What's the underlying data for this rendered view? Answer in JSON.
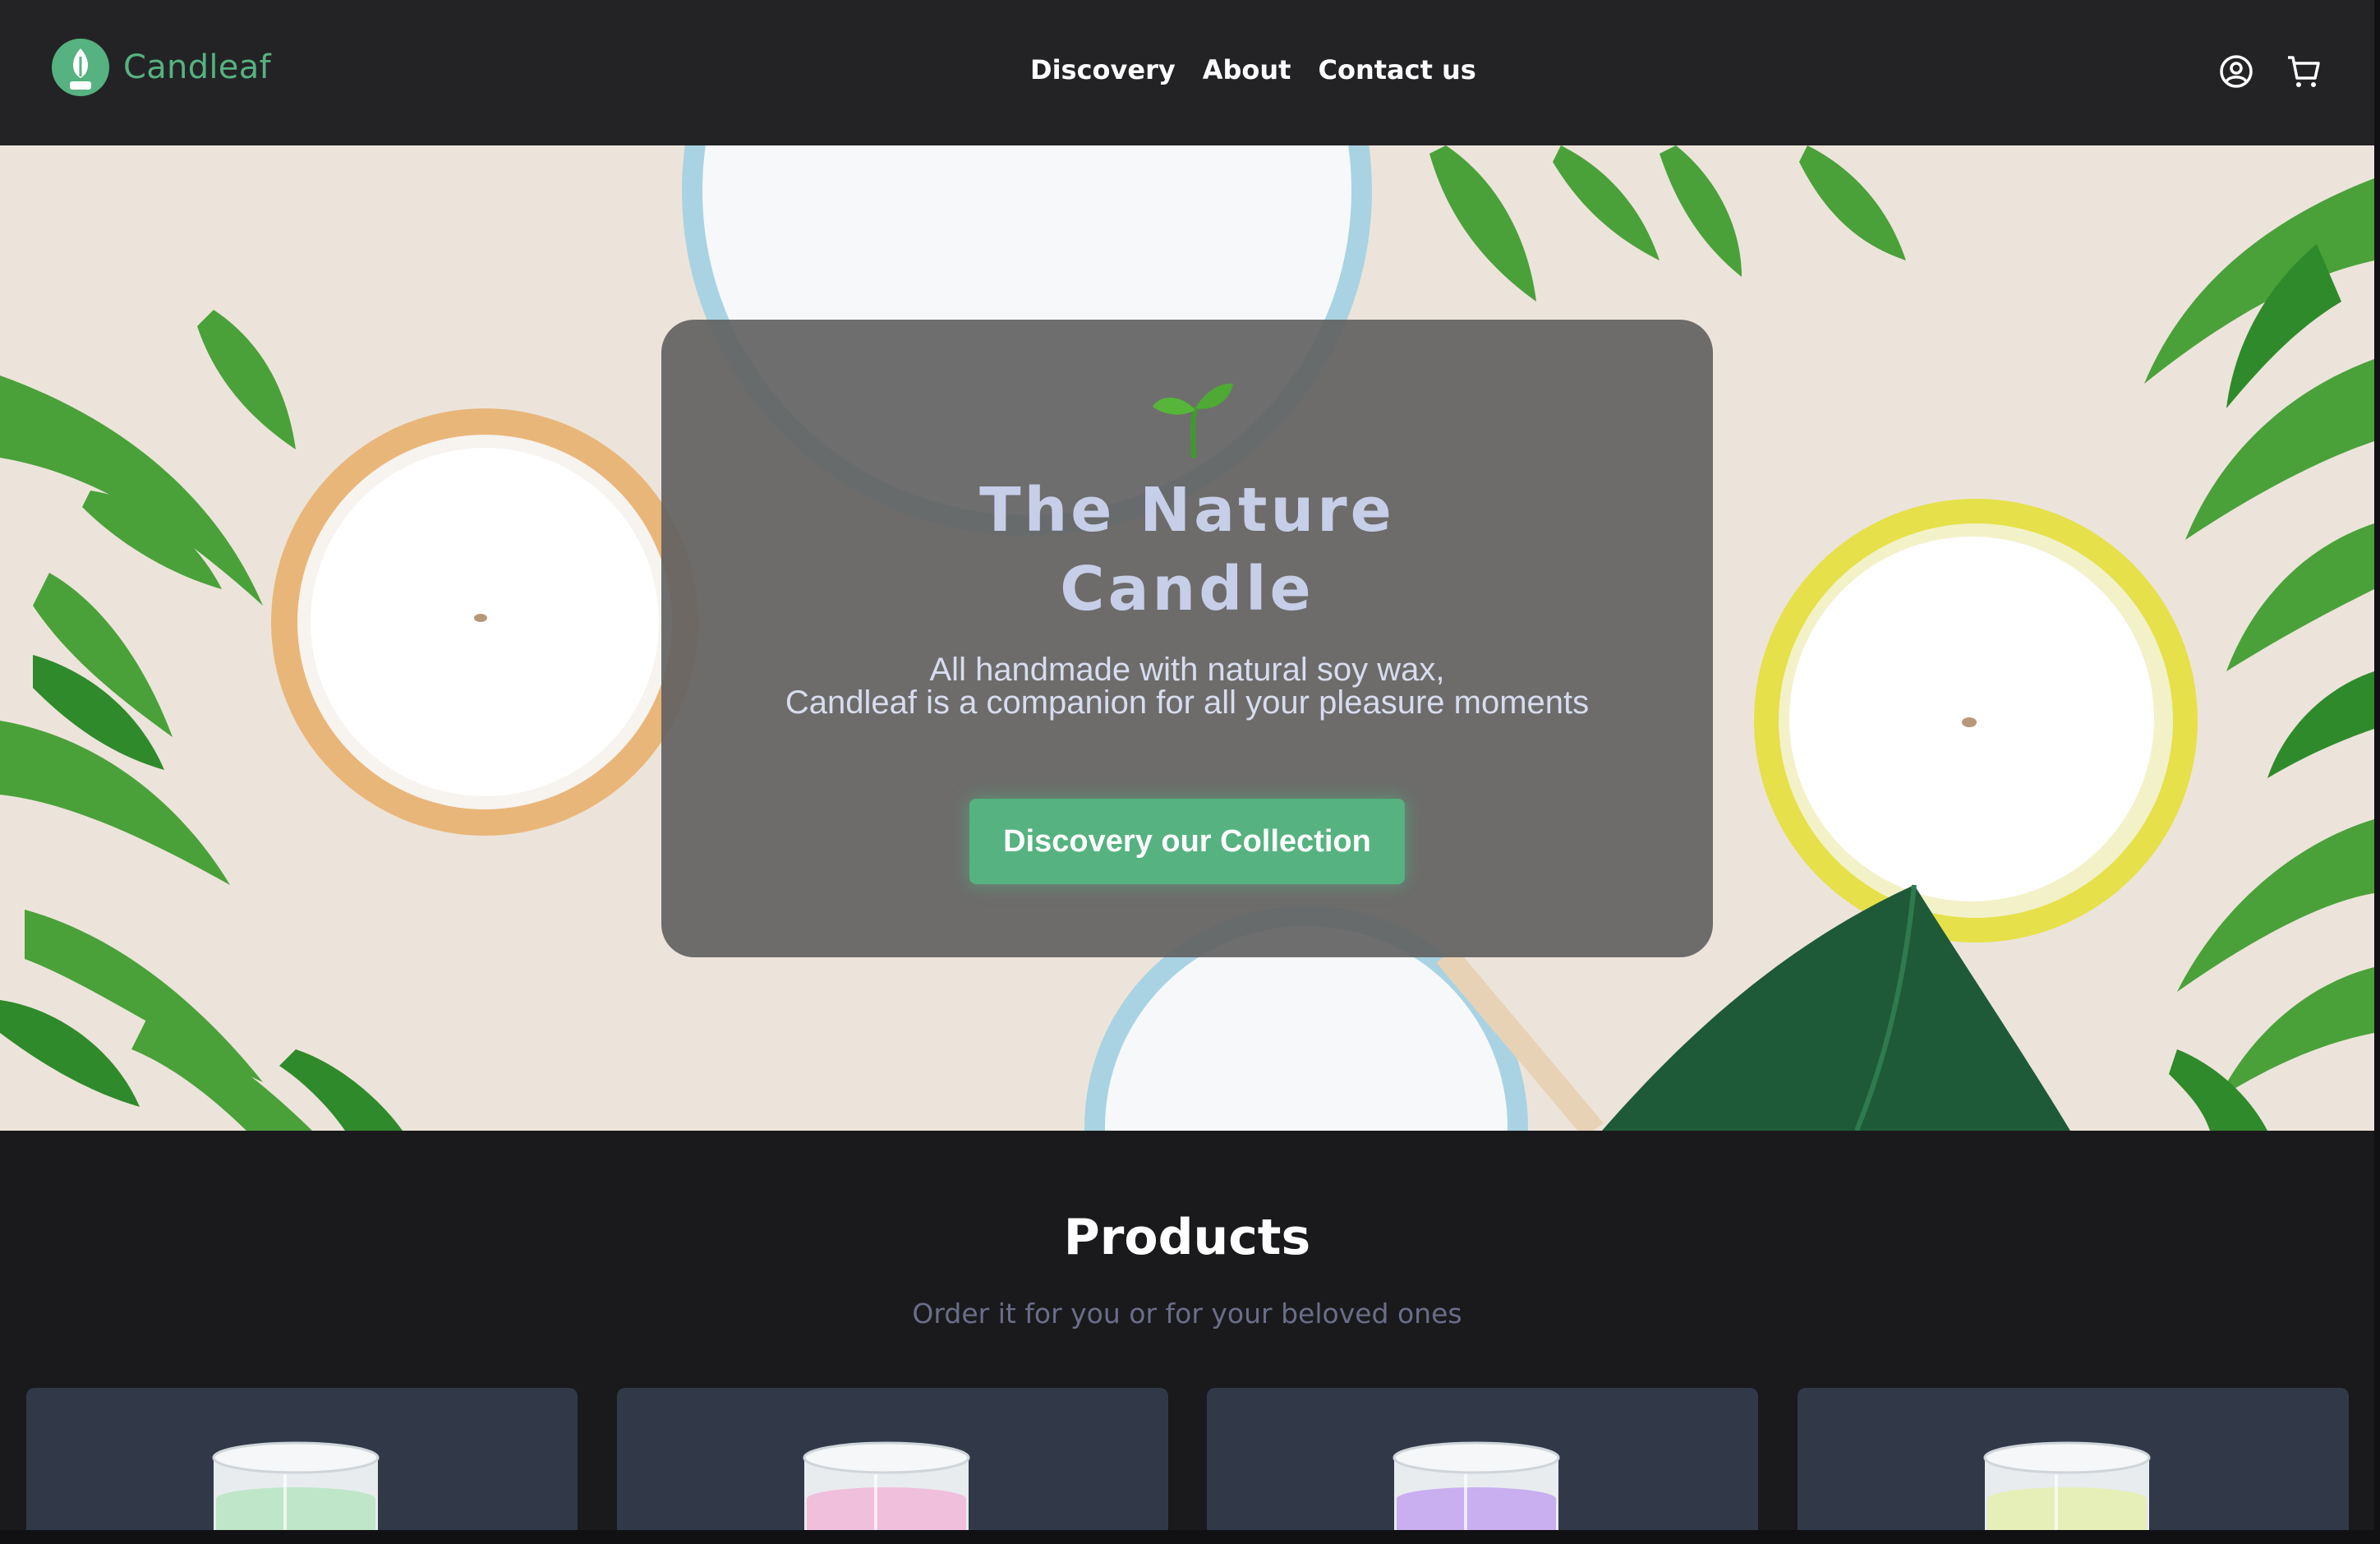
{
  "brand": {
    "name": "Candleaf",
    "accent": "#56b280"
  },
  "nav": {
    "items": [
      "Discovery",
      "About",
      "Contact us"
    ]
  },
  "header_icons": [
    "user-icon",
    "cart-icon"
  ],
  "hero": {
    "title_line1": "The Nature",
    "title_line2": "Candle",
    "subtitle_line1": "All handmade with natural soy wax,",
    "subtitle_line2": "Candleaf is a companion for all your pleasure moments",
    "cta_label": "Discovery our Collection"
  },
  "products": {
    "title": "Products",
    "subtitle": "Order it for you or for your beloved ones",
    "cards": [
      {
        "wax_color": "#bfe6c9"
      },
      {
        "wax_color": "#efbfdc"
      },
      {
        "wax_color": "#c9aef0"
      },
      {
        "wax_color": "#e6efb8"
      }
    ]
  }
}
